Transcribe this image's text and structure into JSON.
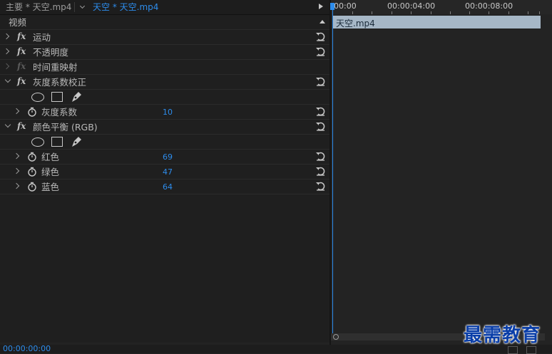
{
  "tabs": {
    "master_label": "主要 * 天空.mp4",
    "clip_label": "天空 * 天空.mp4"
  },
  "section": {
    "title": "视频"
  },
  "effects": [
    {
      "label": "运动"
    },
    {
      "label": "不透明度"
    },
    {
      "label": "时间重映射"
    },
    {
      "label": "灰度系数校正"
    },
    {
      "label": "灰度系数",
      "value": "10"
    },
    {
      "label": "颜色平衡 (RGB)"
    },
    {
      "label": "红色",
      "value": "69"
    },
    {
      "label": "绿色",
      "value": "47"
    },
    {
      "label": "蓝色",
      "value": "64"
    }
  ],
  "timeline": {
    "ruler_labels": [
      "00:00",
      "00:00:04:00",
      "00:00:08:00"
    ],
    "clip_name": "天空.mp4"
  },
  "status": {
    "timecode": "00:00:00:00"
  },
  "watermark": "最需教育",
  "colors": {
    "accent": "#2d8ceb",
    "clip": "#a6b7c6"
  },
  "icons": [
    "play-icon",
    "up-arrow-icon",
    "chevron-right-icon",
    "chevron-down-icon",
    "fx-icon",
    "reset-icon",
    "stopwatch-icon",
    "ellipse-mask-icon",
    "rectangle-mask-icon",
    "pen-mask-icon"
  ]
}
